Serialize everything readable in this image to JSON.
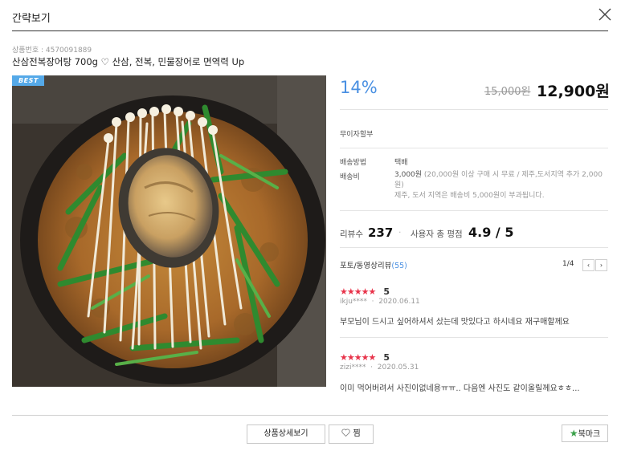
{
  "dialog": {
    "title": "간략보기",
    "close_icon": "close-icon"
  },
  "product": {
    "id_label": "상품번호 : 4570091889",
    "name": "산삼전복장어탕 700g ♡ 산삼, 전복, 민물장어로 면역력 Up",
    "badge": "BEST",
    "discount": "14%",
    "original_price": "15,000원",
    "price": "12,900원",
    "interest_free": "무이자할부"
  },
  "shipping": {
    "method_label": "배송방법",
    "method_value": "택배",
    "fee_label": "배송비",
    "fee_amount": "3,000원",
    "fee_condition": " (20,000원 이상 구매 시 무료 / 제주,도서지역 추가 2,000원)",
    "island_note": "제주, 도서 지역은 배송비 5,000원이 부과됩니다."
  },
  "reviews": {
    "count_label": "리뷰수",
    "count": "237",
    "rating_label": "사용자 총 평점",
    "rating": "4.9",
    "rating_max": "/ 5",
    "photo_label": "포토/동영상리뷰",
    "photo_count": "(55)",
    "pager": "1/4",
    "prev_icon": "chevron-left-icon",
    "next_icon": "chevron-right-icon",
    "items": [
      {
        "stars": "★★★★★",
        "score": "5",
        "user": "ikju****",
        "date": "2020.06.11",
        "text": "부모님이 드시고 싶어하셔서 샀는데 맛있다고 하시네요 재구매할께요"
      },
      {
        "stars": "★★★★★",
        "score": "5",
        "user": "zizi****",
        "date": "2020.05.31",
        "text": "이미 먹어버려서 사진이없네용ㅠㅠ.. 다음엔 사진도 같이올릴께요ㅎㅎ..."
      }
    ]
  },
  "actions": {
    "detail_button": "상품상세보기",
    "wish_button": "찜",
    "wish_icon": "heart-icon",
    "bookmark_button": "북마크",
    "bookmark_icon": "star-icon"
  },
  "colors": {
    "accent": "#4a90e2",
    "star": "#e8334a",
    "bookmark_star": "#3aa14a",
    "badge": "#55a9e8"
  }
}
